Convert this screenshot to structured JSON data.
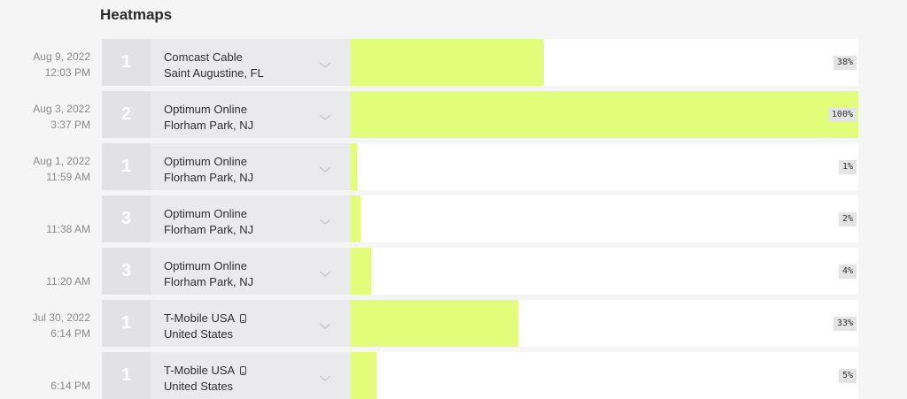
{
  "heading": "Heatmaps",
  "rows": [
    {
      "date": "Aug 9, 2022",
      "time": "12:03 PM",
      "count": "1",
      "isp": "Comcast Cable",
      "mobile": false,
      "location": "Saint Augustine, FL",
      "percent": "38%",
      "fill": 0.38
    },
    {
      "date": "Aug 3, 2022",
      "time": "3:37 PM",
      "count": "2",
      "isp": "Optimum Online",
      "mobile": false,
      "location": "Florham Park, NJ",
      "percent": "100%",
      "fill": 1.0
    },
    {
      "date": "Aug 1, 2022",
      "time": "11:59 AM",
      "count": "1",
      "isp": "Optimum Online",
      "mobile": false,
      "location": "Florham Park, NJ",
      "percent": "1%",
      "fill": 0.01
    },
    {
      "date": "",
      "time": "11:38 AM",
      "count": "3",
      "isp": "Optimum Online",
      "mobile": false,
      "location": "Florham Park, NJ",
      "percent": "2%",
      "fill": 0.02
    },
    {
      "date": "",
      "time": "11:20 AM",
      "count": "3",
      "isp": "Optimum Online",
      "mobile": false,
      "location": "Florham Park, NJ",
      "percent": "4%",
      "fill": 0.04
    },
    {
      "date": "Jul 30, 2022",
      "time": "6:14 PM",
      "count": "1",
      "isp": "T-Mobile USA",
      "mobile": true,
      "location": "United States",
      "percent": "33%",
      "fill": 0.33
    },
    {
      "date": "",
      "time": "6:14 PM",
      "count": "1",
      "isp": "T-Mobile USA",
      "mobile": true,
      "location": "United States",
      "percent": "5%",
      "fill": 0.05
    }
  ],
  "colors": {
    "bar": "#e3fc7a",
    "count_bg": "#e2e2e4",
    "info_bg": "#eaeaec"
  },
  "icons": {
    "expand": "chevron-down-icon",
    "mobile": "mobile-phone-icon"
  }
}
